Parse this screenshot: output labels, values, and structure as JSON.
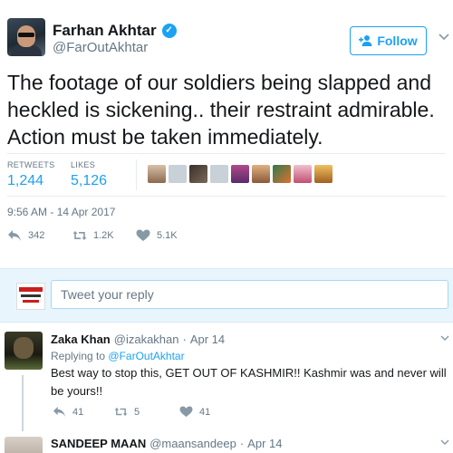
{
  "tweet": {
    "author_name": "Farhan Akhtar",
    "author_handle": "@FarOutAkhtar",
    "follow_label": "Follow",
    "text": "The footage of our soldiers being slapped and heckled is sickening.. their restraint admirable. Action must be taken immediately.",
    "retweets_label": "RETWEETS",
    "retweets_value": "1,244",
    "likes_label": "LIKES",
    "likes_value": "5,126",
    "timestamp": "9:56 AM - 14 Apr 2017",
    "actions": {
      "reply_count": "342",
      "retweet_count": "1.2K",
      "like_count": "5.1K"
    }
  },
  "composer": {
    "placeholder": "Tweet your reply"
  },
  "replies": [
    {
      "name": "Zaka Khan",
      "handle": "@izakakhan",
      "dot": "·",
      "date": "Apr 14",
      "replying_to_prefix": "Replying to",
      "replying_to_handle": "@FarOutAkhtar",
      "text": "Best way to stop this, GET OUT OF KASHMIR!! Kashmir was and never will be yours!!",
      "reply_count": "41",
      "retweet_count": "5",
      "like_count": "41"
    },
    {
      "name": "SANDEEP MAAN",
      "handle": "@maansandeep",
      "dot": "·",
      "date": "Apr 14"
    }
  ],
  "colors": {
    "accent": "#1da1f2",
    "muted": "#657786",
    "composer_bg": "#e8f5fd"
  },
  "icons": {
    "verified": "verified-badge-icon",
    "follow": "add-user-icon",
    "caret": "chevron-down-icon",
    "reply": "reply-icon",
    "retweet": "retweet-icon",
    "like": "heart-icon"
  }
}
